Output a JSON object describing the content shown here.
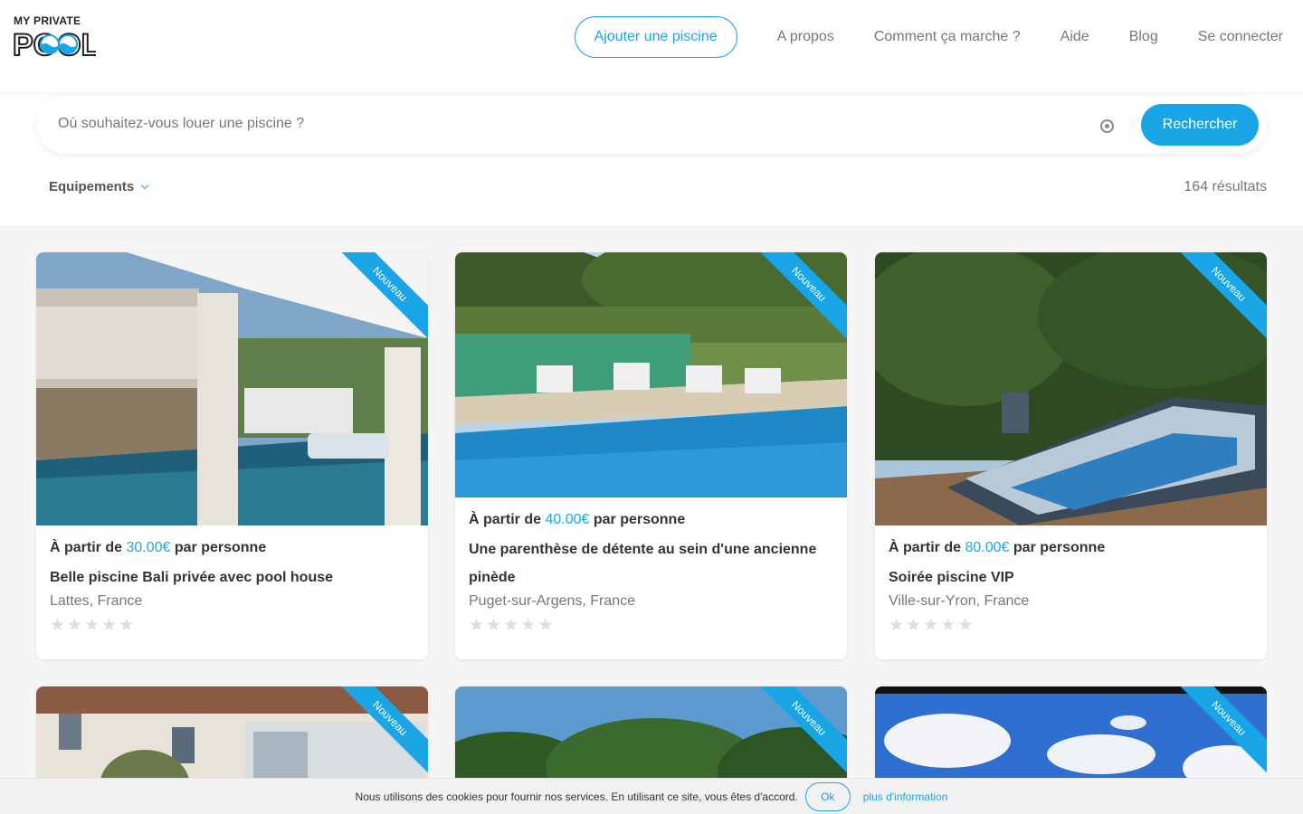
{
  "brand": {
    "logo_top": "MY PRIVATE",
    "logo_bottom": "POOL",
    "accent": "#1aa5e6"
  },
  "nav": {
    "add_pool": "Ajouter une piscine",
    "links": [
      "A propos",
      "Comment ça marche ?",
      "Aide",
      "Blog",
      "Se connecter"
    ]
  },
  "search": {
    "placeholder": "Où souhaitez-vous louer une piscine ?",
    "button": "Rechercher",
    "target_icon": "target-icon"
  },
  "filters": {
    "equipment_label": "Equipements"
  },
  "results": {
    "count_text": "164 résultats"
  },
  "cards": [
    {
      "badge": "Nouveau",
      "price_prefix": "À partir de",
      "price": "30.00€",
      "price_suffix": "par personne",
      "title": "Belle piscine Bali privée avec pool house",
      "location": "Lattes, France",
      "rating": 0
    },
    {
      "badge": "Nouveau",
      "price_prefix": "À partir de",
      "price": "40.00€",
      "price_suffix": "par personne",
      "title": "Une parenthèse de détente au sein d'une ancienne pinède",
      "location": "Puget-sur-Argens, France",
      "rating": 0
    },
    {
      "badge": "Nouveau",
      "price_prefix": "À partir de",
      "price": "80.00€",
      "price_suffix": "par personne",
      "title": "Soirée piscine VIP",
      "location": "Ville-sur-Yron, France",
      "rating": 0
    },
    {
      "badge": "Nouveau"
    },
    {
      "badge": "Nouveau"
    },
    {
      "badge": "Nouveau"
    }
  ],
  "cookie": {
    "text": "Nous utilisons des cookies pour fournir nos services. En utilisant ce site, vous êtes d'accord.",
    "ok": "Ok",
    "more": "plus d'information"
  }
}
